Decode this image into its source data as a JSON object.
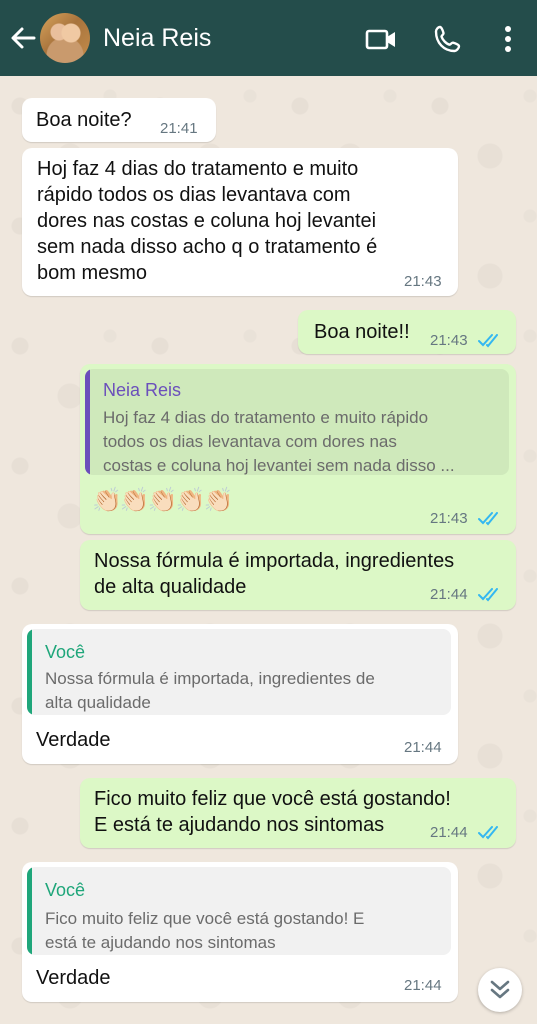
{
  "header": {
    "contact_name": "Neia Reis",
    "icons": [
      "back-arrow-icon",
      "video-call-icon",
      "phone-icon",
      "more-vert-icon"
    ],
    "background_color": "#244d4b"
  },
  "colors": {
    "incoming_bubble": "#ffffff",
    "outgoing_bubble": "#dcf8c6",
    "read_ticks": "#34b7f1",
    "quote_author_contact": "#6b4fbb",
    "quote_author_self": "#1fa67a"
  },
  "messages": [
    {
      "direction": "in",
      "text": "Boa noite?",
      "time": "21:41"
    },
    {
      "direction": "in",
      "lines": [
        "Hoj faz 4 dias do tratamento e muito",
        "rápido todos os dias levantava com",
        "dores nas costas e coluna hoj levantei",
        "sem nada disso acho q o tratamento é",
        "bom mesmo"
      ],
      "time": "21:43"
    },
    {
      "direction": "out",
      "text": "Boa noite!!",
      "time": "21:43",
      "status": "read"
    },
    {
      "direction": "out",
      "quote": {
        "author": "Neia Reis",
        "lines": [
          "Hoj faz 4 dias do tratamento e muito rápido",
          "todos os dias levantava com dores nas",
          "costas e coluna hoj levantei sem nada disso ..."
        ]
      },
      "text": "👏🏻👏🏻👏🏻👏🏻👏🏻",
      "time": "21:43",
      "status": "read"
    },
    {
      "direction": "out",
      "lines": [
        "Nossa fórmula é importada, ingredientes",
        "de alta qualidade"
      ],
      "time": "21:44",
      "status": "read"
    },
    {
      "direction": "in",
      "quote": {
        "author": "Você",
        "lines": [
          "Nossa fórmula é importada, ingredientes de",
          "alta qualidade"
        ]
      },
      "text": "Verdade",
      "time": "21:44"
    },
    {
      "direction": "out",
      "lines": [
        "Fico muito feliz que você está gostando!",
        "E está te ajudando nos sintomas"
      ],
      "time": "21:44",
      "status": "read"
    },
    {
      "direction": "in",
      "quote": {
        "author": "Você",
        "lines": [
          "Fico muito feliz que você está gostando! E",
          "está te ajudando nos sintomas"
        ]
      },
      "text": "Verdade",
      "time": "21:44"
    }
  ],
  "scroll_button_icon": "double-chevron-down-icon"
}
